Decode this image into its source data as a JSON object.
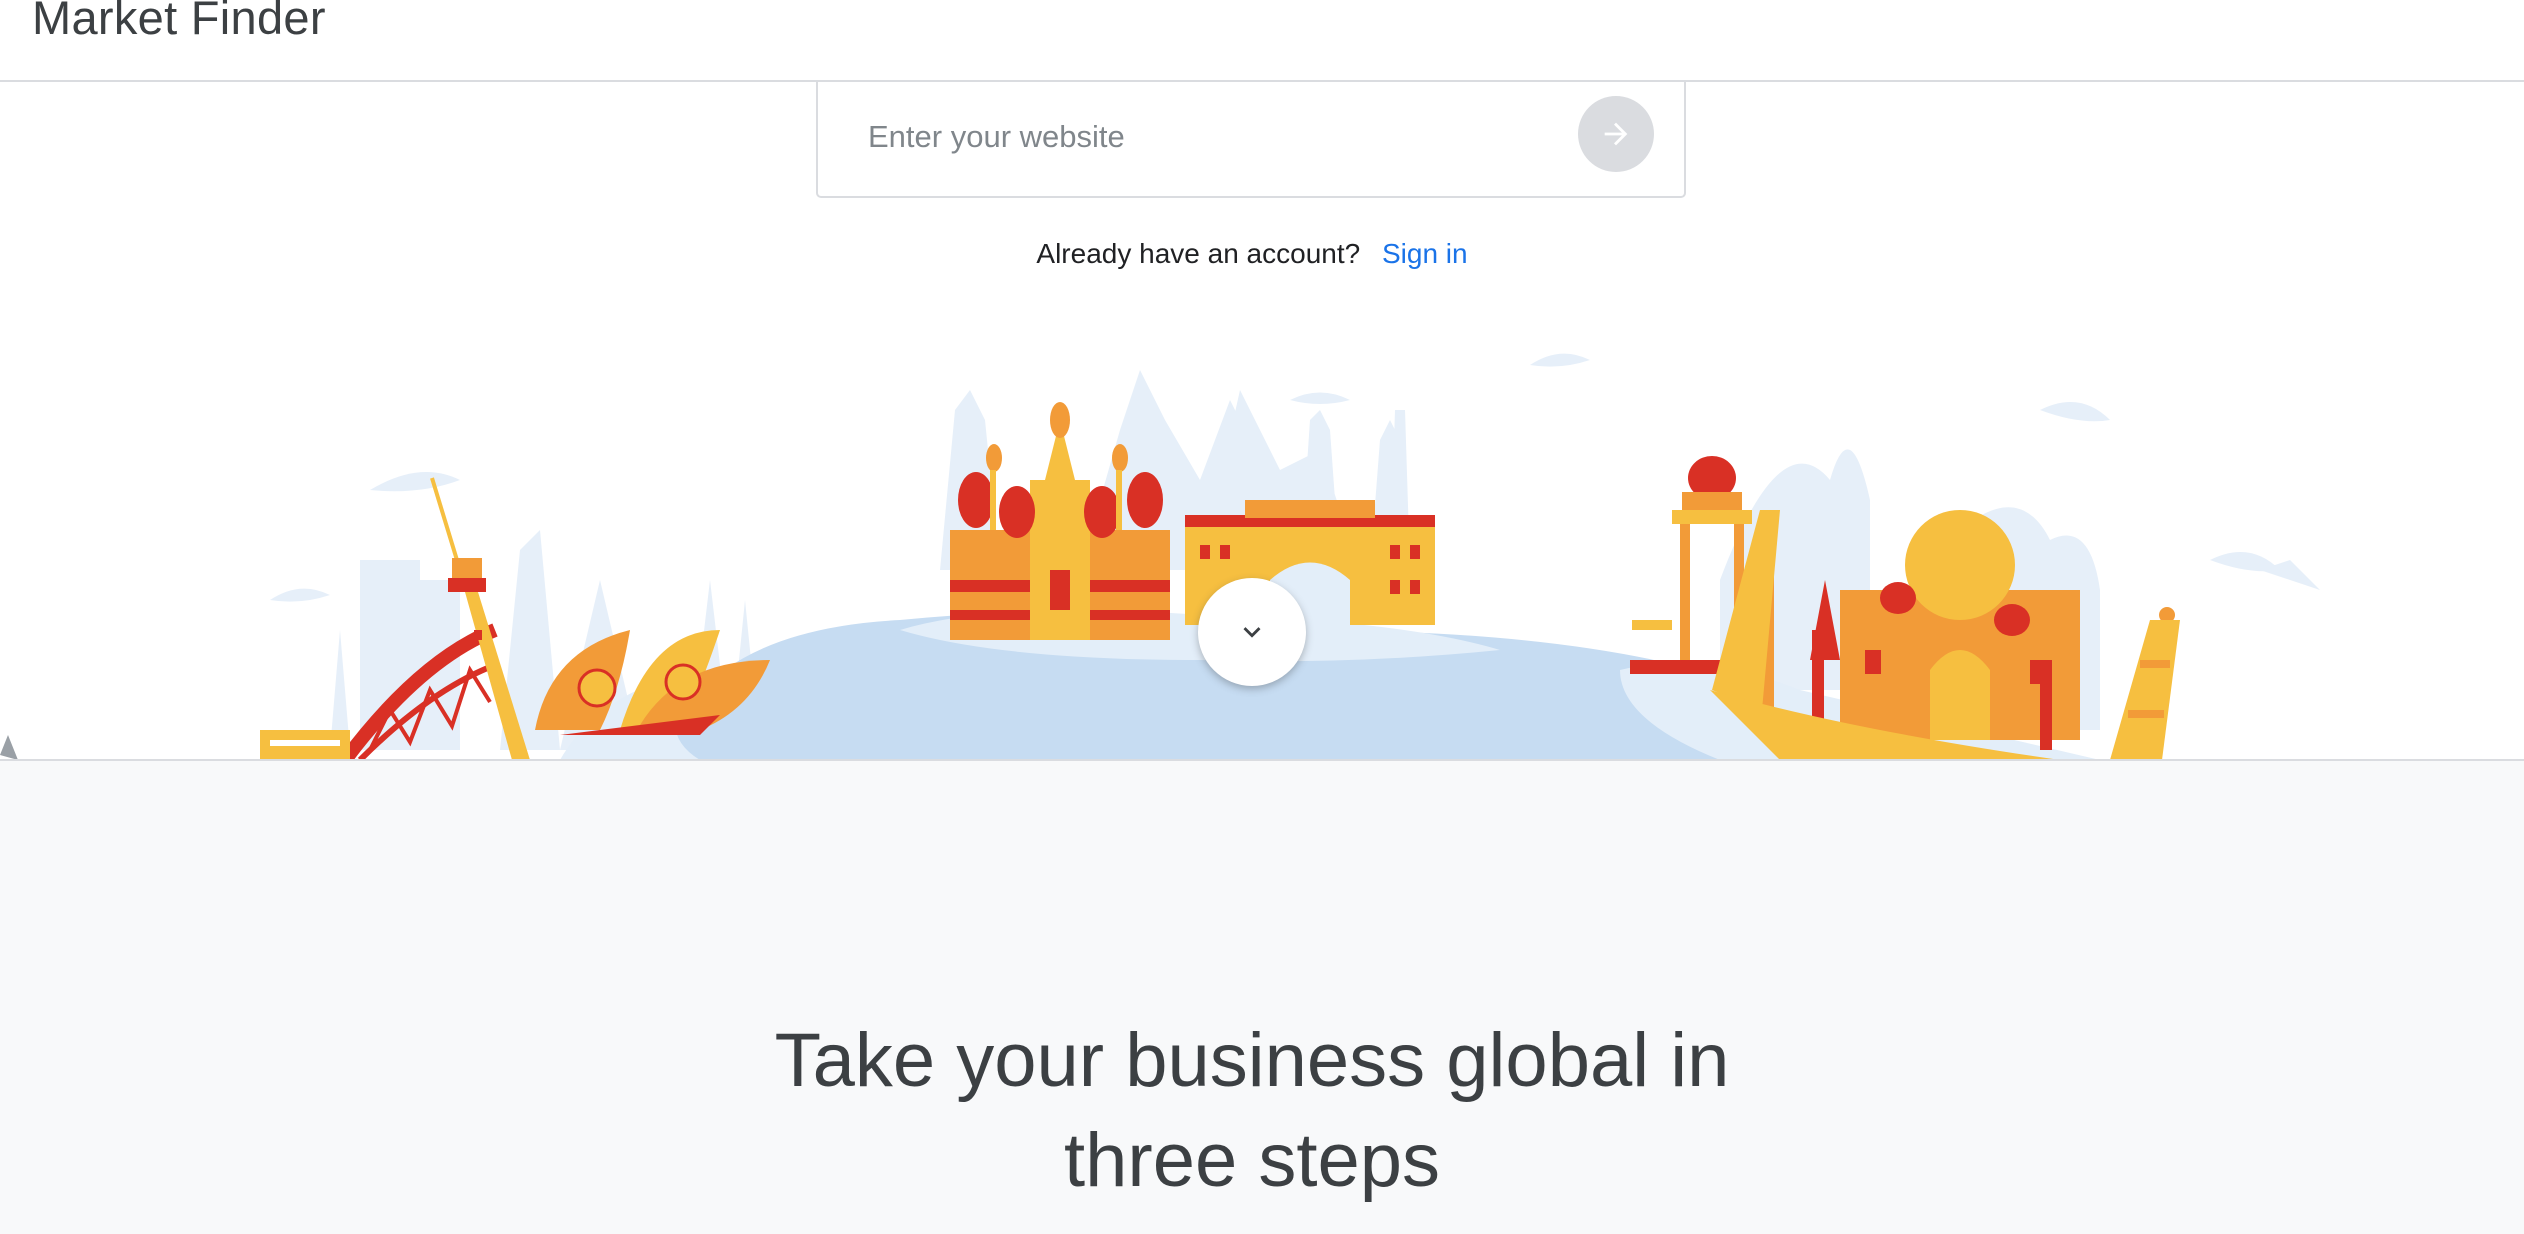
{
  "header": {
    "app_title": "Market Finder"
  },
  "search": {
    "placeholder": "Enter your website",
    "value": ""
  },
  "account": {
    "prompt": "Already have an account?",
    "signin_label": "Sign in"
  },
  "hero": {
    "headline_line1": "Take your business global in",
    "headline_line2": "three steps"
  },
  "icons": {
    "submit": "arrow-right-icon",
    "scroll": "chevron-down-icon"
  },
  "colors": {
    "link": "#1a73e8",
    "submit_bg": "#dadce0",
    "landmark_orange": "#f29b38",
    "landmark_red": "#d93025",
    "landmark_yellow": "#f6bf40",
    "water": "#c6dcf2",
    "skyline": "#e3eef9"
  }
}
